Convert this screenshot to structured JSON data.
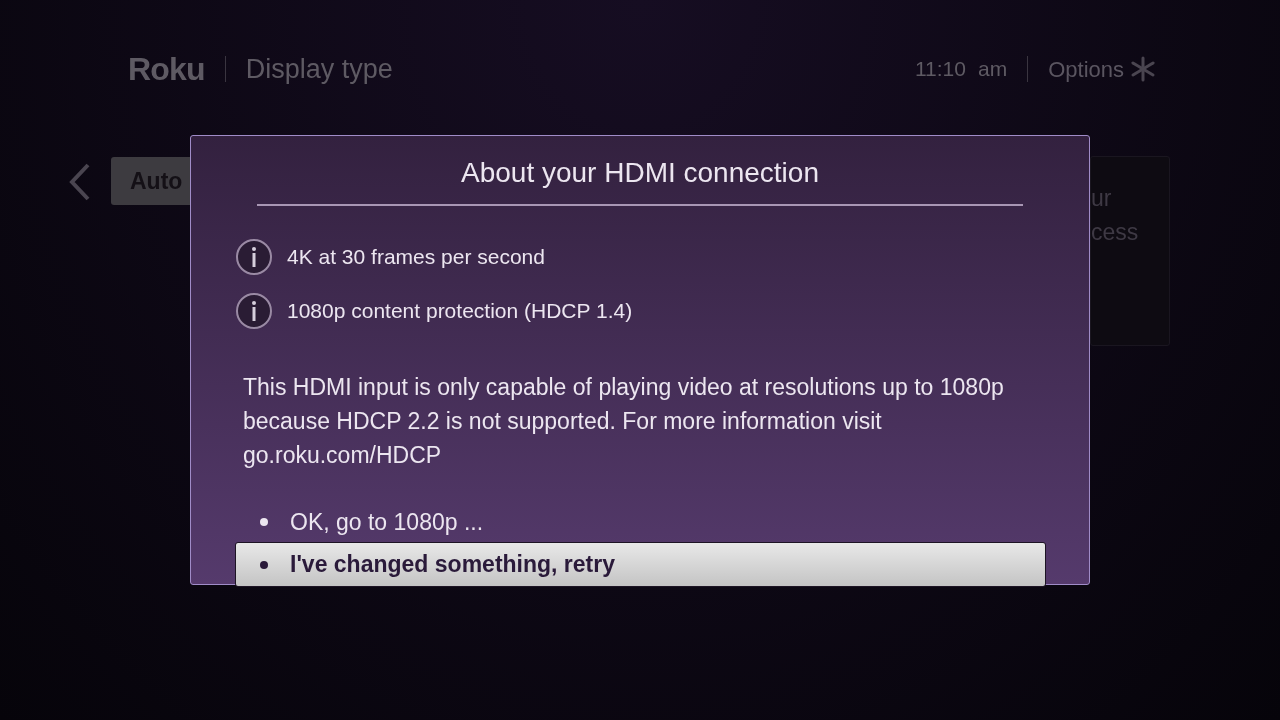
{
  "header": {
    "logo": "Roku",
    "title": "Display type",
    "time": "11:10",
    "meridiem": "am",
    "options": "Options"
  },
  "background": {
    "button": "Auto",
    "panel_lines": [
      "ur",
      "cess"
    ]
  },
  "dialog": {
    "title": "About your HDMI connection",
    "info": [
      "4K at 30 frames per second",
      "1080p content protection (HDCP 1.4)"
    ],
    "message": "This HDMI input is only capable of playing video at resolutions up to 1080p because HDCP 2.2 is not supported. For more information visit go.roku.com/HDCP",
    "options": [
      {
        "label": "OK, go to 1080p ...",
        "selected": false
      },
      {
        "label": "I've changed something, retry",
        "selected": true
      }
    ]
  }
}
